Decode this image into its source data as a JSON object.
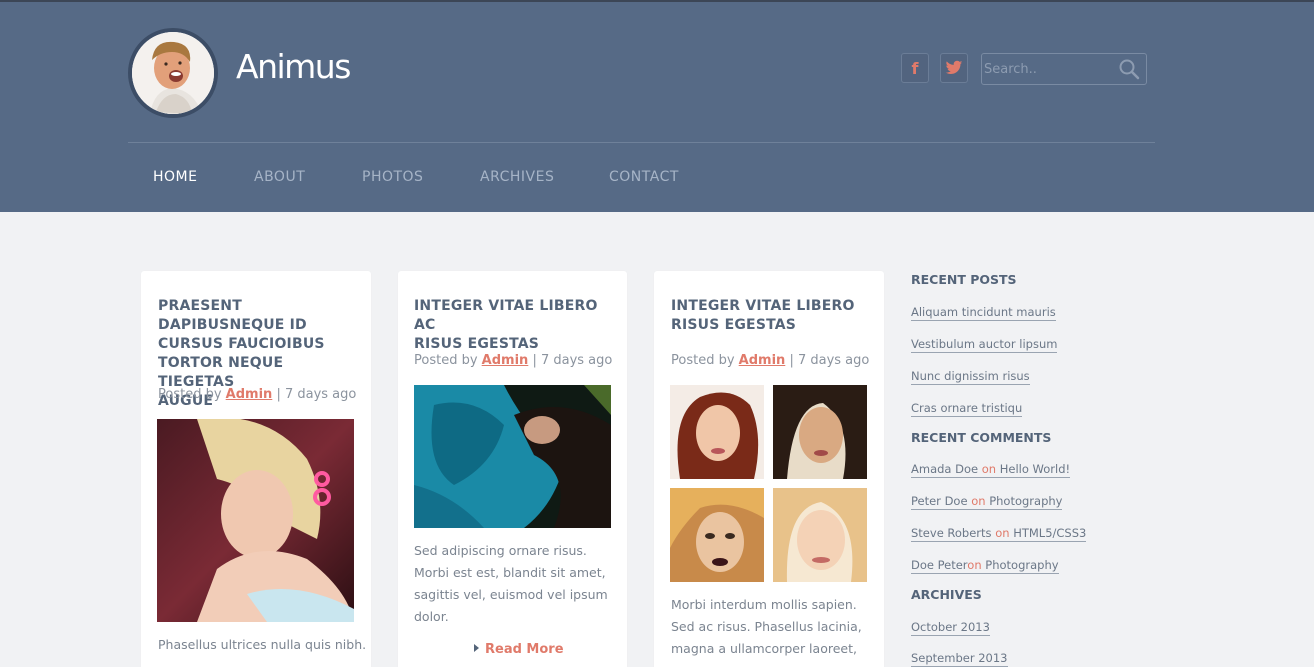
{
  "site": {
    "title": "Animus"
  },
  "search": {
    "placeholder": "Search.."
  },
  "social": {
    "facebook_glyph": "f",
    "twitter_icon": "twitter-bird-icon"
  },
  "nav": {
    "items": [
      {
        "label": "HOME"
      },
      {
        "label": "ABOUT"
      },
      {
        "label": "PHOTOS"
      },
      {
        "label": "ARCHIVES"
      },
      {
        "label": "CONTACT"
      }
    ]
  },
  "posts": [
    {
      "title_lines": [
        "PRAESENT DAPIBUSNEQUE ID",
        "CURSUS FAUCIOIBUS",
        "TORTOR NEQUE TIEGETAS",
        "AUGUE"
      ],
      "posted_by": "Posted by",
      "author": "Admin",
      "time": "| 7 days ago",
      "excerpt_lines": [
        "Phasellus ultrices nulla quis nibh."
      ]
    },
    {
      "title_lines": [
        "INTEGER VITAE LIBERO AC",
        "RISUS EGESTAS"
      ],
      "posted_by": "Posted by",
      "author": "Admin",
      "time": "| 7 days ago",
      "excerpt_lines": [
        "Sed adipiscing ornare risus.",
        "Morbi est est, blandit sit amet,",
        "sagittis vel, euismod vel ipsum",
        "dolor."
      ],
      "read_more": "Read More"
    },
    {
      "title_lines": [
        "INTEGER VITAE LIBERO",
        "RISUS EGESTAS"
      ],
      "posted_by": "Posted by",
      "author": "Admin",
      "time": "| 7 days ago",
      "excerpt_lines": [
        "Morbi interdum mollis sapien.",
        "Sed ac risus. Phasellus lacinia,",
        "magna a ullamcorper laoreet,"
      ]
    }
  ],
  "sidebar": {
    "recent_posts": {
      "heading": "RECENT POSTS",
      "items": [
        "Aliquam tincidunt mauris",
        "Vestibulum auctor lipsum",
        "Nunc dignissim risus",
        "Cras ornare tristiqu"
      ]
    },
    "recent_comments": {
      "heading": "RECENT COMMENTS",
      "on": "on",
      "items": [
        {
          "author": "Amada Doe",
          "post": "Hello World!"
        },
        {
          "author": "Peter Doe",
          "post": "Photography"
        },
        {
          "author": "Steve Roberts",
          "post": "HTML5/CSS3"
        },
        {
          "author": "Doe Peter",
          "post": "Photography"
        }
      ]
    },
    "archives": {
      "heading": "ARCHIVES",
      "items": [
        "October 2013",
        "September 2013"
      ]
    }
  },
  "colors": {
    "header_bg": "#566a86",
    "page_bg": "#f1f2f4",
    "accent": "#e07a6a",
    "heading": "#546479"
  }
}
